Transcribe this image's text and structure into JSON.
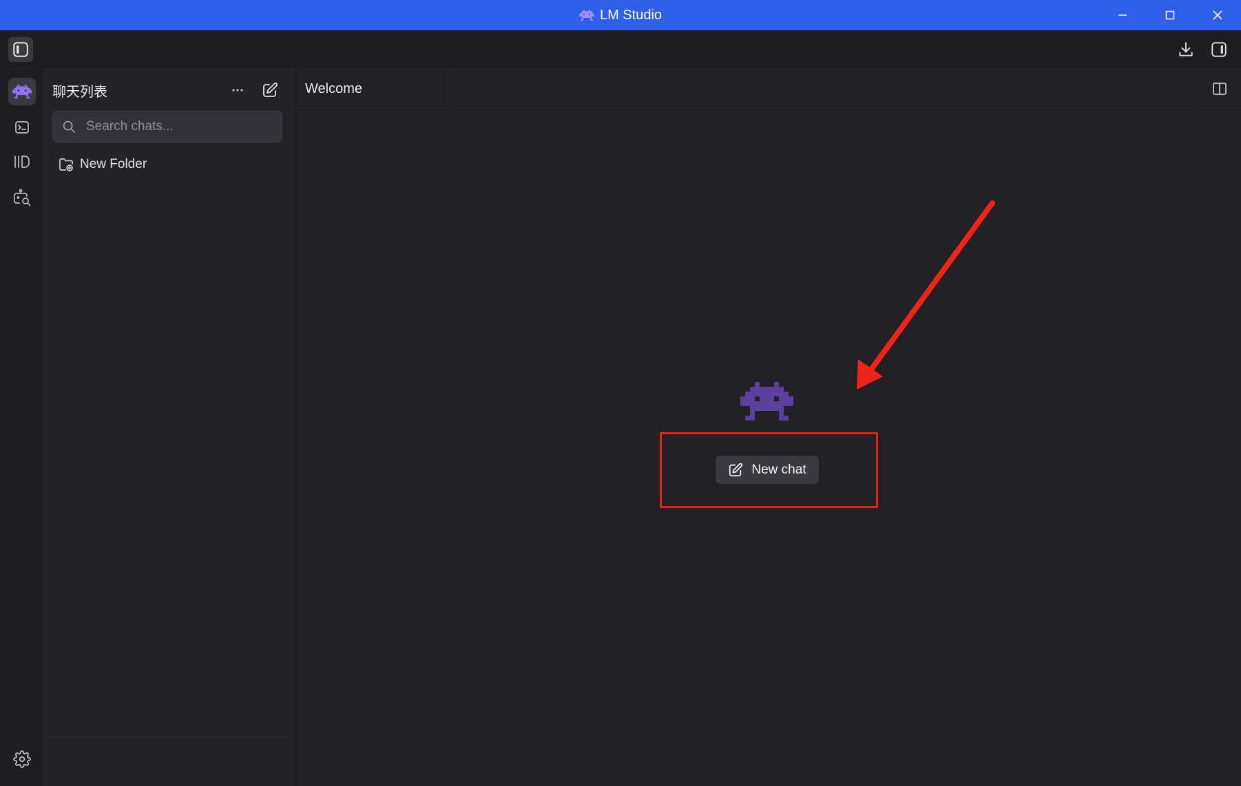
{
  "window": {
    "title": "LM Studio"
  },
  "sidebar": {
    "title": "聊天列表"
  },
  "search": {
    "placeholder": "Search chats..."
  },
  "folders": [
    {
      "label": "New Folder"
    }
  ],
  "tabs": [
    {
      "label": "Welcome"
    }
  ],
  "main": {
    "new_chat_label": "New chat"
  },
  "colors": {
    "titlebar": "#2f5ee8",
    "accent_purple": "#7a5cd6",
    "logo_purple": "#5a3f9c",
    "highlight_red": "#e8201a"
  },
  "icons": {
    "titlebar": "lm-studio-logo-icon",
    "toolbar_left": "toggle-sidebar-icon",
    "toolbar_right": [
      "download-icon",
      "toggle-right-panel-icon"
    ],
    "rail": [
      "chat-robot-icon",
      "terminal-icon",
      "library-icon",
      "discover-search-icon",
      "settings-gear-icon"
    ],
    "chat_panel": [
      "more-dots-icon",
      "new-chat-edit-icon",
      "search-icon",
      "new-folder-icon"
    ],
    "tabbar": [
      "split-view-icon"
    ],
    "center": [
      "lm-studio-logo-icon",
      "edit-icon"
    ]
  }
}
